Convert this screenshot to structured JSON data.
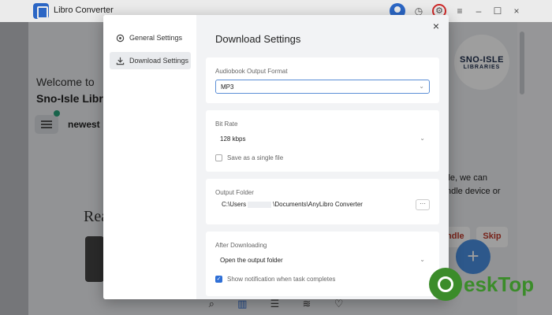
{
  "app": {
    "title": "Libro Converter",
    "welcome": "Welcome to",
    "library": "Sno-Isle Librari",
    "filter_label": "newest",
    "promo_text": "Rea",
    "brand_line1": "SNO-ISLE",
    "brand_line2": "LIBRARIES",
    "side_text_1": "lle, we can",
    "side_text_2": "ndle device or",
    "bundle_label": "ndle",
    "skip_label": "Skip",
    "accent_color": "#2f6fd6"
  },
  "modal": {
    "nav": [
      {
        "label": "General Settings",
        "icon": "gear-icon"
      },
      {
        "label": "Download Settings",
        "icon": "download-icon"
      }
    ],
    "title": "Download Settings",
    "close_symbol": "×",
    "format_card": {
      "label": "Audiobook Output Format",
      "value": "MP3"
    },
    "bitrate_card": {
      "label": "Bit Rate",
      "value": "128 kbps",
      "checkbox_label": "Save as a single file",
      "checked": false
    },
    "folder_card": {
      "label": "Output Folder",
      "path_prefix": "C:\\Users",
      "path_suffix": "\\Documents\\AnyLibro Converter",
      "browse_label": "···"
    },
    "after_card": {
      "label": "After Downloading",
      "value": "Open the output folder",
      "checkbox_label": "Show notification when task completes",
      "checked": true
    }
  },
  "watermark": {
    "text": "eskTop"
  }
}
